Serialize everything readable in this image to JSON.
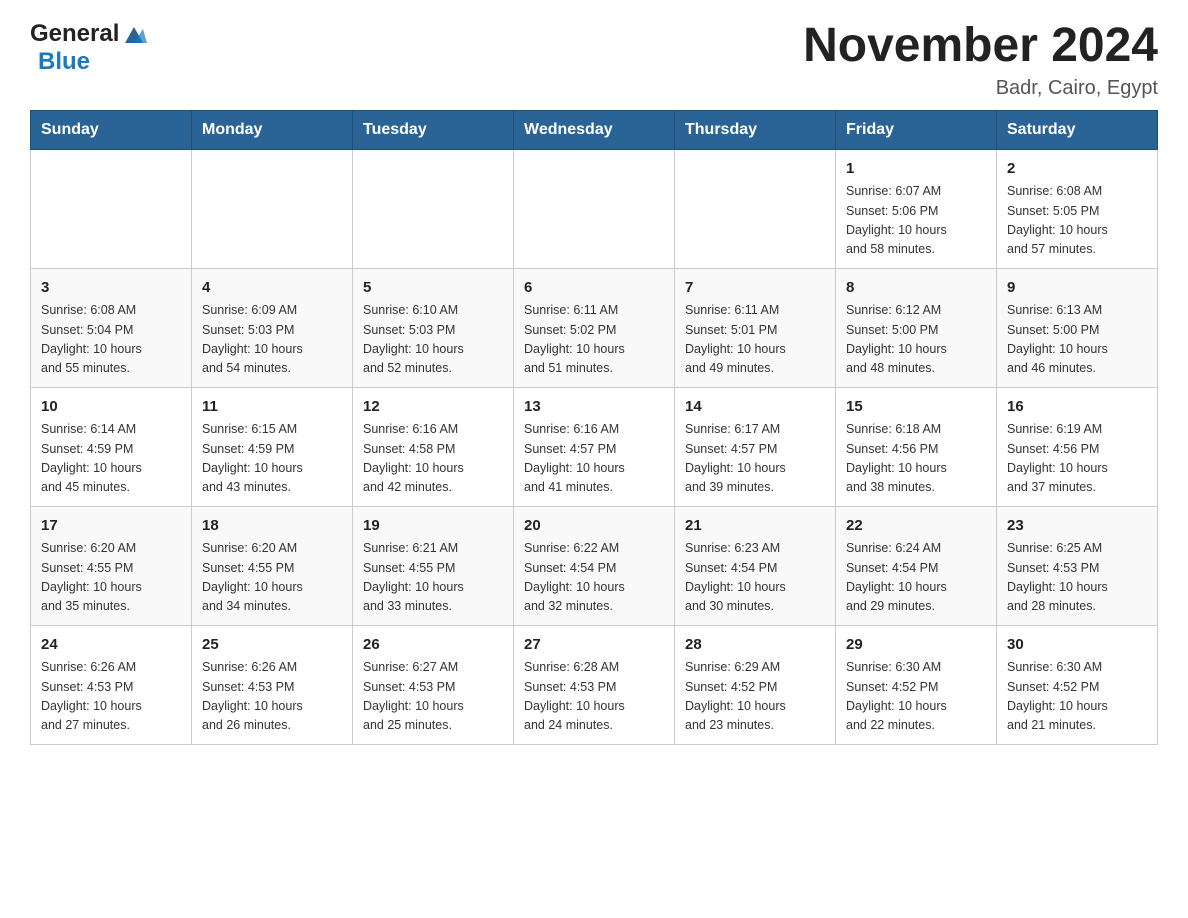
{
  "header": {
    "logo_general": "General",
    "logo_blue": "Blue",
    "title": "November 2024",
    "subtitle": "Badr, Cairo, Egypt"
  },
  "days_of_week": [
    "Sunday",
    "Monday",
    "Tuesday",
    "Wednesday",
    "Thursday",
    "Friday",
    "Saturday"
  ],
  "weeks": [
    [
      {
        "day": "",
        "info": ""
      },
      {
        "day": "",
        "info": ""
      },
      {
        "day": "",
        "info": ""
      },
      {
        "day": "",
        "info": ""
      },
      {
        "day": "",
        "info": ""
      },
      {
        "day": "1",
        "info": "Sunrise: 6:07 AM\nSunset: 5:06 PM\nDaylight: 10 hours\nand 58 minutes."
      },
      {
        "day": "2",
        "info": "Sunrise: 6:08 AM\nSunset: 5:05 PM\nDaylight: 10 hours\nand 57 minutes."
      }
    ],
    [
      {
        "day": "3",
        "info": "Sunrise: 6:08 AM\nSunset: 5:04 PM\nDaylight: 10 hours\nand 55 minutes."
      },
      {
        "day": "4",
        "info": "Sunrise: 6:09 AM\nSunset: 5:03 PM\nDaylight: 10 hours\nand 54 minutes."
      },
      {
        "day": "5",
        "info": "Sunrise: 6:10 AM\nSunset: 5:03 PM\nDaylight: 10 hours\nand 52 minutes."
      },
      {
        "day": "6",
        "info": "Sunrise: 6:11 AM\nSunset: 5:02 PM\nDaylight: 10 hours\nand 51 minutes."
      },
      {
        "day": "7",
        "info": "Sunrise: 6:11 AM\nSunset: 5:01 PM\nDaylight: 10 hours\nand 49 minutes."
      },
      {
        "day": "8",
        "info": "Sunrise: 6:12 AM\nSunset: 5:00 PM\nDaylight: 10 hours\nand 48 minutes."
      },
      {
        "day": "9",
        "info": "Sunrise: 6:13 AM\nSunset: 5:00 PM\nDaylight: 10 hours\nand 46 minutes."
      }
    ],
    [
      {
        "day": "10",
        "info": "Sunrise: 6:14 AM\nSunset: 4:59 PM\nDaylight: 10 hours\nand 45 minutes."
      },
      {
        "day": "11",
        "info": "Sunrise: 6:15 AM\nSunset: 4:59 PM\nDaylight: 10 hours\nand 43 minutes."
      },
      {
        "day": "12",
        "info": "Sunrise: 6:16 AM\nSunset: 4:58 PM\nDaylight: 10 hours\nand 42 minutes."
      },
      {
        "day": "13",
        "info": "Sunrise: 6:16 AM\nSunset: 4:57 PM\nDaylight: 10 hours\nand 41 minutes."
      },
      {
        "day": "14",
        "info": "Sunrise: 6:17 AM\nSunset: 4:57 PM\nDaylight: 10 hours\nand 39 minutes."
      },
      {
        "day": "15",
        "info": "Sunrise: 6:18 AM\nSunset: 4:56 PM\nDaylight: 10 hours\nand 38 minutes."
      },
      {
        "day": "16",
        "info": "Sunrise: 6:19 AM\nSunset: 4:56 PM\nDaylight: 10 hours\nand 37 minutes."
      }
    ],
    [
      {
        "day": "17",
        "info": "Sunrise: 6:20 AM\nSunset: 4:55 PM\nDaylight: 10 hours\nand 35 minutes."
      },
      {
        "day": "18",
        "info": "Sunrise: 6:20 AM\nSunset: 4:55 PM\nDaylight: 10 hours\nand 34 minutes."
      },
      {
        "day": "19",
        "info": "Sunrise: 6:21 AM\nSunset: 4:55 PM\nDaylight: 10 hours\nand 33 minutes."
      },
      {
        "day": "20",
        "info": "Sunrise: 6:22 AM\nSunset: 4:54 PM\nDaylight: 10 hours\nand 32 minutes."
      },
      {
        "day": "21",
        "info": "Sunrise: 6:23 AM\nSunset: 4:54 PM\nDaylight: 10 hours\nand 30 minutes."
      },
      {
        "day": "22",
        "info": "Sunrise: 6:24 AM\nSunset: 4:54 PM\nDaylight: 10 hours\nand 29 minutes."
      },
      {
        "day": "23",
        "info": "Sunrise: 6:25 AM\nSunset: 4:53 PM\nDaylight: 10 hours\nand 28 minutes."
      }
    ],
    [
      {
        "day": "24",
        "info": "Sunrise: 6:26 AM\nSunset: 4:53 PM\nDaylight: 10 hours\nand 27 minutes."
      },
      {
        "day": "25",
        "info": "Sunrise: 6:26 AM\nSunset: 4:53 PM\nDaylight: 10 hours\nand 26 minutes."
      },
      {
        "day": "26",
        "info": "Sunrise: 6:27 AM\nSunset: 4:53 PM\nDaylight: 10 hours\nand 25 minutes."
      },
      {
        "day": "27",
        "info": "Sunrise: 6:28 AM\nSunset: 4:53 PM\nDaylight: 10 hours\nand 24 minutes."
      },
      {
        "day": "28",
        "info": "Sunrise: 6:29 AM\nSunset: 4:52 PM\nDaylight: 10 hours\nand 23 minutes."
      },
      {
        "day": "29",
        "info": "Sunrise: 6:30 AM\nSunset: 4:52 PM\nDaylight: 10 hours\nand 22 minutes."
      },
      {
        "day": "30",
        "info": "Sunrise: 6:30 AM\nSunset: 4:52 PM\nDaylight: 10 hours\nand 21 minutes."
      }
    ]
  ]
}
